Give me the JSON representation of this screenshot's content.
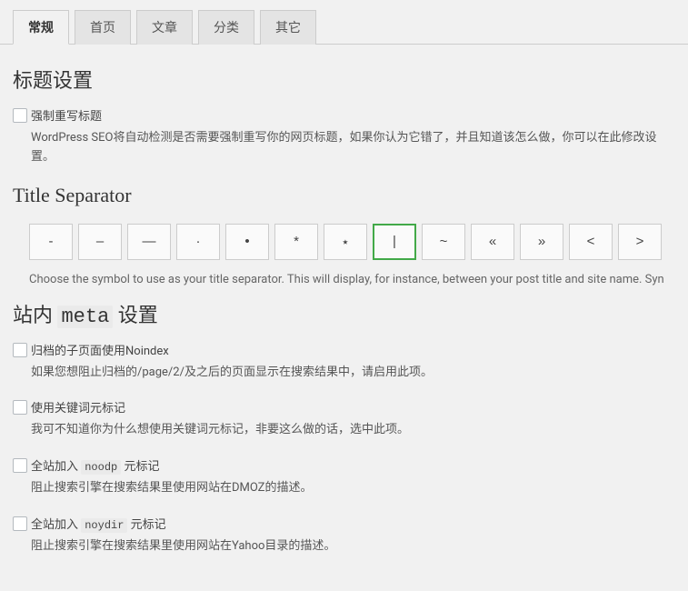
{
  "tabs": {
    "items": [
      {
        "label": "常规",
        "active": true
      },
      {
        "label": "首页",
        "active": false
      },
      {
        "label": "文章",
        "active": false
      },
      {
        "label": "分类",
        "active": false
      },
      {
        "label": "其它",
        "active": false
      }
    ]
  },
  "sections": {
    "title_settings_heading": "标题设置",
    "force_rewrite": {
      "label": "强制重写标题",
      "desc": "WordPress SEO将自动检测是否需要强制重写你的网页标题，如果你认为它错了，并且知道该怎么做，你可以在此修改设置。"
    },
    "title_separator_heading": "Title Separator",
    "separator_help": "Choose the symbol to use as your title separator. This will display, for instance, between your post title and site name. Syn",
    "separators": [
      "-",
      "–",
      "—",
      "·",
      "•",
      "*",
      "⋆",
      "|",
      "~",
      "«",
      "»",
      "<",
      ">"
    ],
    "selected_separator_index": 7,
    "meta_heading_pre": "站内 ",
    "meta_heading_code": "meta",
    "meta_heading_post": " 设置",
    "noindex_subpages": {
      "label": "归档的子页面使用Noindex",
      "desc": "如果您想阻止归档的/page/2/及之后的页面显示在搜索结果中，请启用此项。"
    },
    "meta_keywords": {
      "label": "使用关键词元标记",
      "desc": "我可不知道你为什么想使用关键词元标记，非要这么做的话，选中此项。"
    },
    "noodp": {
      "label_pre": "全站加入 ",
      "tag": "noodp",
      "label_post": " 元标记",
      "desc": "阻止搜索引擎在搜索结果里使用网站在DMOZ的描述。"
    },
    "noydir": {
      "label_pre": "全站加入 ",
      "tag": "noydir",
      "label_post": " 元标记",
      "desc": "阻止搜索引擎在搜索结果里使用网站在Yahoo目录的描述。"
    }
  }
}
